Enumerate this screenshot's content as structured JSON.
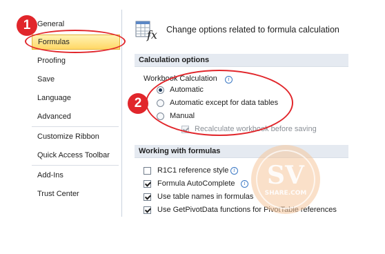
{
  "nav": {
    "items": [
      {
        "label": "General"
      },
      {
        "label": "Formulas"
      },
      {
        "label": "Proofing"
      },
      {
        "label": "Save"
      },
      {
        "label": "Language"
      },
      {
        "label": "Advanced"
      },
      {
        "label": "Customize Ribbon"
      },
      {
        "label": "Quick Access Toolbar"
      },
      {
        "label": "Add-Ins"
      },
      {
        "label": "Trust Center"
      }
    ],
    "selected": "Formulas"
  },
  "header": {
    "text": "Change options related to formula calculation",
    "icon": "formula-fx-icon"
  },
  "calculation": {
    "section_title": "Calculation options",
    "group_label": "Workbook Calculation",
    "options": [
      {
        "label": "Automatic",
        "checked": true
      },
      {
        "label": "Automatic except for data tables",
        "checked": false
      },
      {
        "label": "Manual",
        "checked": false
      }
    ],
    "recalc_label": "Recalculate workbook before saving"
  },
  "formulas": {
    "section_title": "Working with formulas",
    "options": [
      {
        "label": "R1C1 reference style",
        "checked": false
      },
      {
        "label": "Formula AutoComplete",
        "checked": true
      },
      {
        "label": "Use table names in formulas",
        "checked": true
      },
      {
        "label": "Use GetPivotData functions for PivotTable references",
        "checked": true
      }
    ]
  },
  "annotations": {
    "badge_1": "1",
    "badge_2": "2",
    "color": "#e1262b"
  },
  "watermark": {
    "top": "SV",
    "bottom": "SHARE.COM"
  }
}
